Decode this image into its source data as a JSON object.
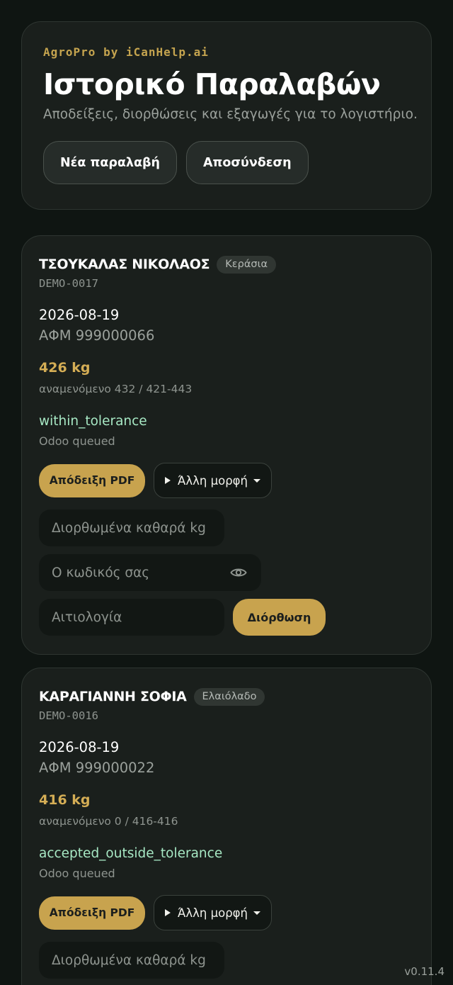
{
  "header": {
    "brand": "AgroPro by iCanHelp.ai",
    "title": "Ιστορικό Παραλαβών",
    "subtitle": "Αποδείξεις, διορθώσεις και εξαγωγές για το λογιστήριο.",
    "new_receipt_label": "Νέα παραλαβή",
    "logout_label": "Αποσύνδεση"
  },
  "receipts": [
    {
      "supplier": "ΤΣΟΥΚΑΛΑΣ ΝΙΚΟΛΑΟΣ",
      "product": "Κεράσια",
      "code": "DEMO-0017",
      "date": "2026-08-19",
      "afm": "ΑΦΜ 999000066",
      "weight": "426 kg",
      "expected": "αναμενόμενο 432 / 421-443",
      "status": "within_tolerance",
      "sync": "Odoo queued",
      "pdf_label": "Απόδειξη PDF",
      "more_label": "Άλλη μορφή",
      "kg_placeholder": "Διορθωμένα καθαρά kg",
      "password_placeholder": "Ο κωδικός σας",
      "reason_placeholder": "Αιτιολογία",
      "correct_label": "Διόρθωση"
    },
    {
      "supplier": "ΚΑΡΑΓΙΑΝΝΗ ΣΟΦΙΑ",
      "product": "Ελαιόλαδο",
      "code": "DEMO-0016",
      "date": "2026-08-19",
      "afm": "ΑΦΜ 999000022",
      "weight": "416 kg",
      "expected": "αναμενόμενο 0 / 416-416",
      "status": "accepted_outside_tolerance",
      "sync": "Odoo queued",
      "pdf_label": "Απόδειξη PDF",
      "more_label": "Άλλη μορφή",
      "kg_placeholder": "Διορθωμένα καθαρά kg"
    }
  ],
  "version": "v0.11.4",
  "colors": {
    "background": "#0f1512",
    "card": "#1a1f1c",
    "accent_gold": "#c8a34e",
    "status_green": "#a7e8c4"
  }
}
